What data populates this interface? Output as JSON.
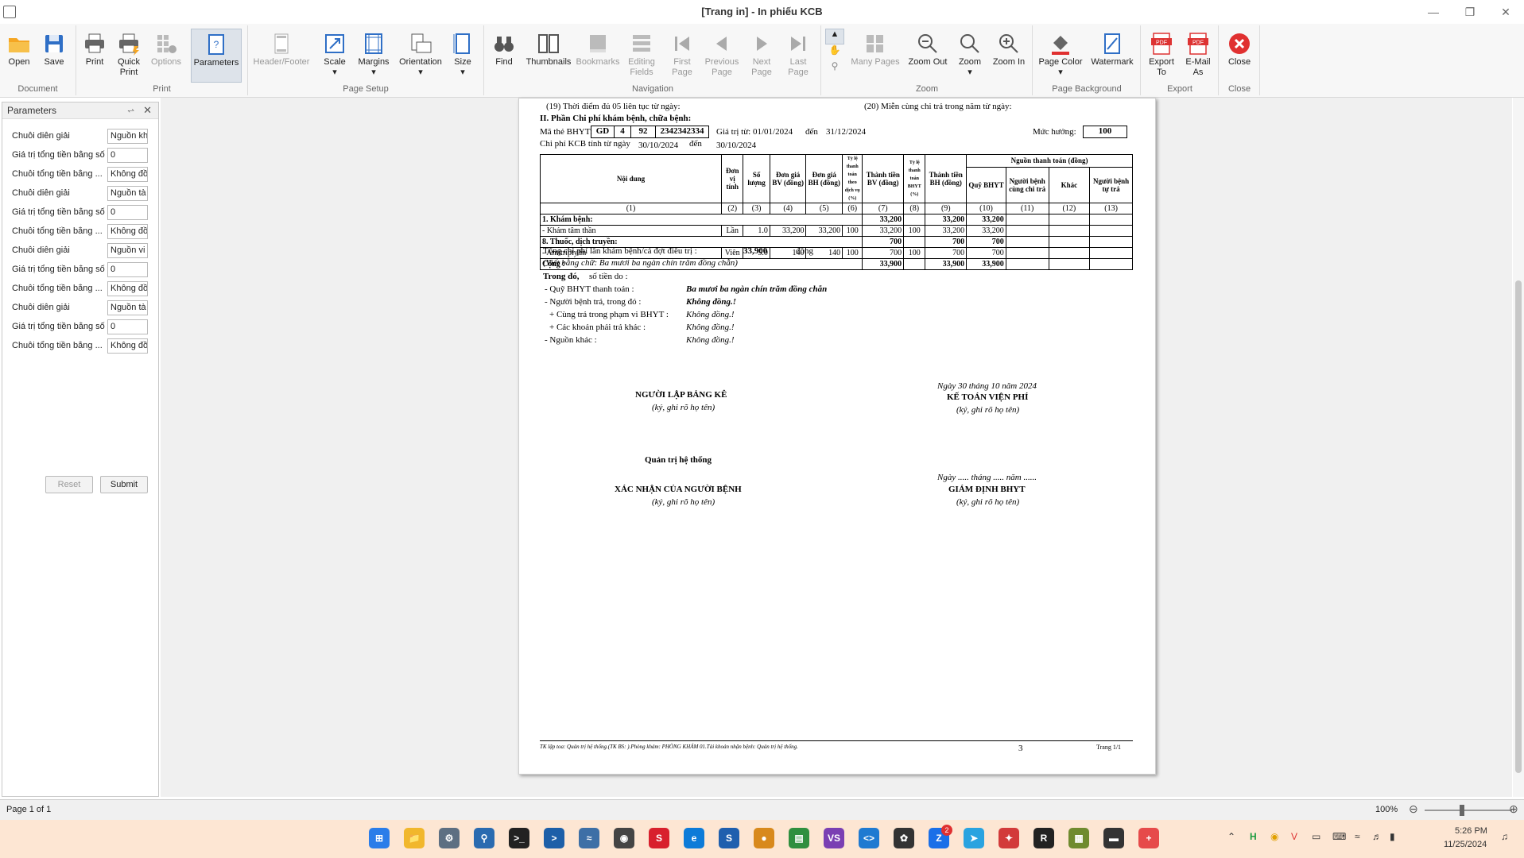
{
  "window": {
    "title": "[Trang in] - In phiếu KCB"
  },
  "ribbon": {
    "groups": [
      "Document",
      "Print",
      "Page Setup",
      "Navigation",
      "Zoom",
      "Page Background",
      "Export",
      "Close"
    ],
    "buttons": {
      "open": "Open",
      "save": "Save",
      "print": "Print",
      "quick_print_1": "Quick",
      "quick_print_2": "Print",
      "options": "Options",
      "parameters": "Parameters",
      "header_footer": "Header/Footer",
      "scale": "Scale",
      "margins": "Margins",
      "orientation": "Orientation",
      "size": "Size",
      "find": "Find",
      "thumbnails": "Thumbnails",
      "bookmarks": "Bookmarks",
      "editing_1": "Editing",
      "editing_2": "Fields",
      "first_1": "First",
      "first_2": "Page",
      "prev_1": "Previous",
      "prev_2": "Page",
      "next_1": "Next",
      "next_2": "Page",
      "last_1": "Last",
      "last_2": "Page",
      "many_pages": "Many Pages",
      "zoom_out": "Zoom Out",
      "zoom": "Zoom",
      "zoom_in": "Zoom In",
      "page_color": "Page Color",
      "watermark": "Watermark",
      "export_1": "Export",
      "export_2": "To",
      "email_1": "E-Mail",
      "email_2": "As",
      "close": "Close"
    }
  },
  "parameters": {
    "title": "Parameters",
    "rows": [
      {
        "label": "Chuỗi diễn giải",
        "value": "Nguồn kh"
      },
      {
        "label": "Giá trị tổng tiền bằng số",
        "value": "0"
      },
      {
        "label": "Chuỗi tổng tiền bằng ...",
        "value": "Không đồ"
      },
      {
        "label": "Chuỗi diễn giải",
        "value": "Nguồn tà"
      },
      {
        "label": "Giá trị tổng tiền bằng số",
        "value": "0"
      },
      {
        "label": "Chuỗi tổng tiền bằng ...",
        "value": "Không đồ"
      },
      {
        "label": "Chuỗi diễn giải",
        "value": "Nguồn vi"
      },
      {
        "label": "Giá trị tổng tiền bằng số",
        "value": "0"
      },
      {
        "label": "Chuỗi tổng tiền bằng ...",
        "value": "Không đồ"
      },
      {
        "label": "Chuỗi diễn giải",
        "value": "Nguồn tà"
      },
      {
        "label": "Giá trị tổng tiền bằng số",
        "value": "0"
      },
      {
        "label": "Chuỗi tổng tiền bằng ...",
        "value": "Không đồ"
      }
    ],
    "reset": "Reset",
    "submit": "Submit"
  },
  "document": {
    "line19": "(19) Thời điểm đủ 05 liên tục từ ngày:",
    "line20": "(20) Miễn cùng chi trả trong năm từ ngày:",
    "section2": "II. Phần Chi phí khám bệnh, chữa bệnh:",
    "card_label": "Mã thẻ BHYT:",
    "card": [
      "GD",
      "4",
      "92",
      "2342342334"
    ],
    "valid_from_label": "Giá trị từ:",
    "valid_from": "01/01/2024",
    "to_label": "đến",
    "valid_to": "31/12/2024",
    "rate_label": "Mức hưởng:",
    "rate": "100",
    "kcb_label": "Chi phí KCB tính từ ngày",
    "kcb_from": "30/10/2024",
    "kcb_to": "30/10/2024",
    "headers": {
      "noi_dung": "Nội dung",
      "don_vi": "Đơn vị tính",
      "so_luong": "Số lượng",
      "dg_bv": "Đơn giá BV (đồng)",
      "dg_bh": "Đơn giá BH (đồng)",
      "ty_le_tt": "Tỷ lệ thanh toán theo dịch vụ (%)",
      "tt_bv": "Thành tiền BV (đồng)",
      "ty_le_bhyt": "Tỷ lệ thanh toán BHYT (%)",
      "tt_bh": "Thành tiền BH (đồng)",
      "nguon": "Nguồn thanh toán (đồng)",
      "quy": "Quỹ BHYT",
      "nguoi_benh_cung": "Người bệnh cùng chi trả",
      "khac": "Khác",
      "nguoi_benh_tu": "Người bệnh tự trả"
    },
    "col_numbers": [
      "(1)",
      "(2)",
      "(3)",
      "(4)",
      "(5)",
      "(6)",
      "(7)",
      "(8)",
      "(9)",
      "(10)",
      "(11)",
      "(12)",
      "(13)"
    ],
    "group1": {
      "title": "1. Khám bệnh:",
      "tt_bv": "33,200",
      "tt_bh": "33,200",
      "quy": "33,200"
    },
    "item1": {
      "name": "- Khám tâm thần",
      "unit": "Lần",
      "qty": "1.0",
      "dg_bv": "33,200",
      "dg_bh": "33,200",
      "tl": "100",
      "tt_bv": "33,200",
      "tl_bhyt": "100",
      "tt_bh": "33,200",
      "quy": "33,200"
    },
    "group8": {
      "title": "8. Thuốc, dịch truyền:",
      "tt_bv": "700",
      "tt_bh": "700",
      "quy": "700"
    },
    "item8": {
      "name": "- Amitriptylin",
      "unit": "Viên",
      "qty": "5.0",
      "dg_bv": "140",
      "dg_bh": "140",
      "tl": "100",
      "tt_bv": "700",
      "tl_bhyt": "100",
      "tt_bh": "700",
      "quy": "700"
    },
    "total": {
      "label": "Cộng :",
      "tt_bv": "33,900",
      "tt_bh": "33,900",
      "quy": "33,900"
    },
    "sum_label": "Tổng chi phí lần khám bệnh/cả đợt điều trị :",
    "sum_value": "33,900",
    "sum_unit": "đồng",
    "words": "(Viết bằng chữ: Ba mươi ba ngàn chín trăm đồng chẵn)",
    "trong_do": "Trong đó,",
    "so_tien_do": "số tiền do :",
    "quy_label": "- Quỹ BHYT thanh toán :",
    "quy_value": "Ba mươi ba ngàn chín trăm đồng chẵn",
    "nb_label": "- Người bệnh trả, trong đó :",
    "nb_value": "Không đồng.!",
    "cung_label": "+ Cùng trả trong phạm vi BHYT :",
    "cung_value": "Không đồng.!",
    "khac_label": "+ Các khoản phải trả khác :",
    "khac_value": "Không đồng.!",
    "nguon_label": "- Nguồn khác :",
    "nguon_value": "Không đồng.!",
    "sig_left_title": "NGƯỜI LẬP BẢNG KÊ",
    "sig_hint": "(ký, ghi rõ họ tên)",
    "sig_right_date": "Ngày 30 tháng 10 năm 2024",
    "sig_right_title": "KẾ TOÁN VIỆN PHÍ",
    "admin_name": "Quản trị hệ thống",
    "patient_title": "XÁC NHẬN CỦA NGƯỜI BỆNH",
    "blank_date": "Ngày ..... tháng ..... năm ......",
    "gd_title": "GIÁM ĐỊNH BHYT",
    "footer_left": "TK lập toa: Quản trị hệ thống.(TK BS: ).Phòng khám: PHÒNG KHÁM 01.Tài khoản nhận bệnh: Quản trị hệ thống.",
    "footer_mid": "3",
    "footer_right": "Trang 1/1"
  },
  "status": {
    "page": "Page 1 of 1",
    "zoom": "100%"
  },
  "taskbar": {
    "time": "5:26 PM",
    "date": "11/25/2024",
    "zalo_badge": "2"
  }
}
